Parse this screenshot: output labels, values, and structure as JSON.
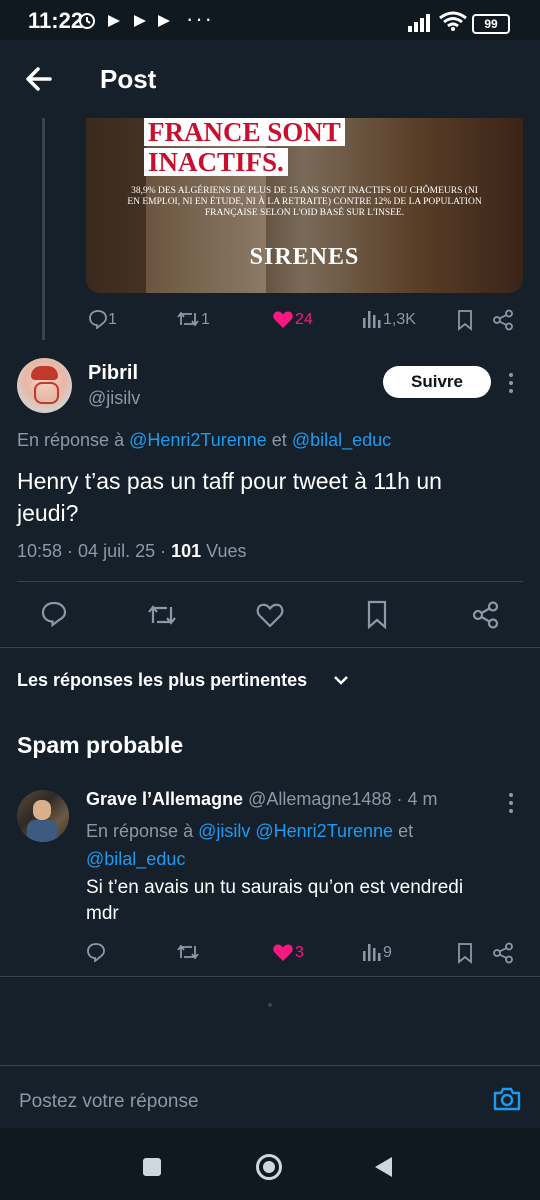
{
  "status": {
    "time": "11:22",
    "battery": "99"
  },
  "header": {
    "title": "Post"
  },
  "prev_tweet": {
    "image_text": {
      "headline_line1": "FRANCE SONT",
      "headline_line2": "INACTIFS.",
      "body_line1": "38,9% DES ALGÉRIENS DE PLUS DE 15 ANS SONT INACTIFS OU CHÔMEURS (NI",
      "body_line2": "EN EMPLOI, NI EN ÉTUDE, NI À LA RETRAITE) CONTRE 12% DE LA POPULATION",
      "body_line3": "FRANÇAISE SELON L'OID BASÉ SUR L'INSEE.",
      "brand": "SIRENES"
    },
    "replies": "1",
    "retweets": "1",
    "likes": "24",
    "views": "1,3K"
  },
  "main_tweet": {
    "name": "Pibril",
    "handle": "@jisilv",
    "follow_label": "Suivre",
    "reply_prefix": "En réponse à",
    "reply_to_1": "@Henri2Turenne",
    "reply_and": "et",
    "reply_to_2": "@bilal_educ",
    "text": "Henry t’as pas un taff pour tweet à 11h un jeudi?",
    "time": "10:58",
    "date": "04 juil. 25",
    "views_count": "101",
    "views_label": "Vues"
  },
  "sort_label": "Les réponses les plus pertinentes",
  "spam_section": "Spam probable",
  "reply_tweet": {
    "name": "Grave l’Allemagne",
    "handle": "@Allemagne1488",
    "age": "4 m",
    "reply_prefix": "En réponse à",
    "reply_to_1": "@jisilv",
    "reply_to_2": "@Henri2Turenne",
    "reply_and": "et",
    "reply_to_3": "@bilal_educ",
    "text_line1": "Si t’en avais un tu saurais qu’on est vendredi",
    "text_line2": "mdr",
    "likes": "3",
    "views": "9"
  },
  "compose": {
    "placeholder": "Postez votre réponse"
  },
  "colors": {
    "background": "#15202b",
    "accent": "#1d9bf0",
    "like": "#f91880",
    "muted": "#8b98a5"
  }
}
